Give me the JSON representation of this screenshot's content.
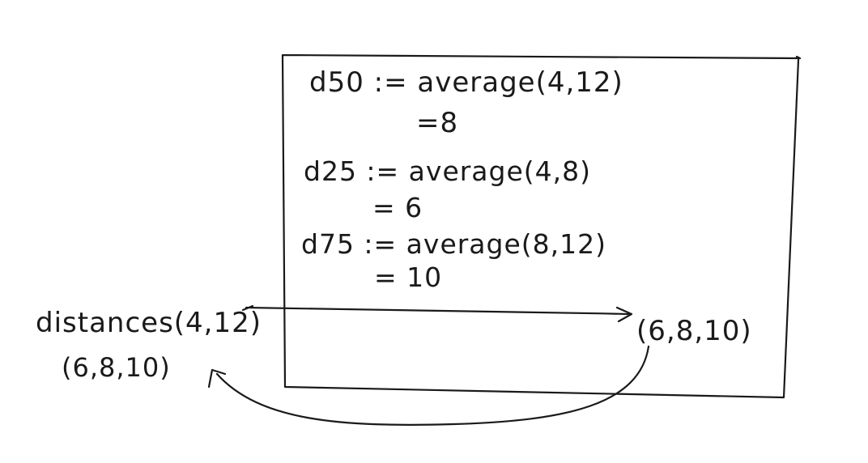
{
  "box": {
    "lines": [
      {
        "text": "d50 := average(4,12)"
      },
      {
        "text": "=8"
      },
      {
        "text": "d25 := average(4,8)"
      },
      {
        "text": "= 6"
      },
      {
        "text": "d75 := average(8,12)"
      },
      {
        "text": "= 10"
      }
    ],
    "result": "(6,8,10)"
  },
  "caller": {
    "call": "distances(4,12)",
    "result": "(6,8,10)"
  },
  "colors": {
    "ink": "#1a1a1a",
    "paper": "#ffffff"
  }
}
